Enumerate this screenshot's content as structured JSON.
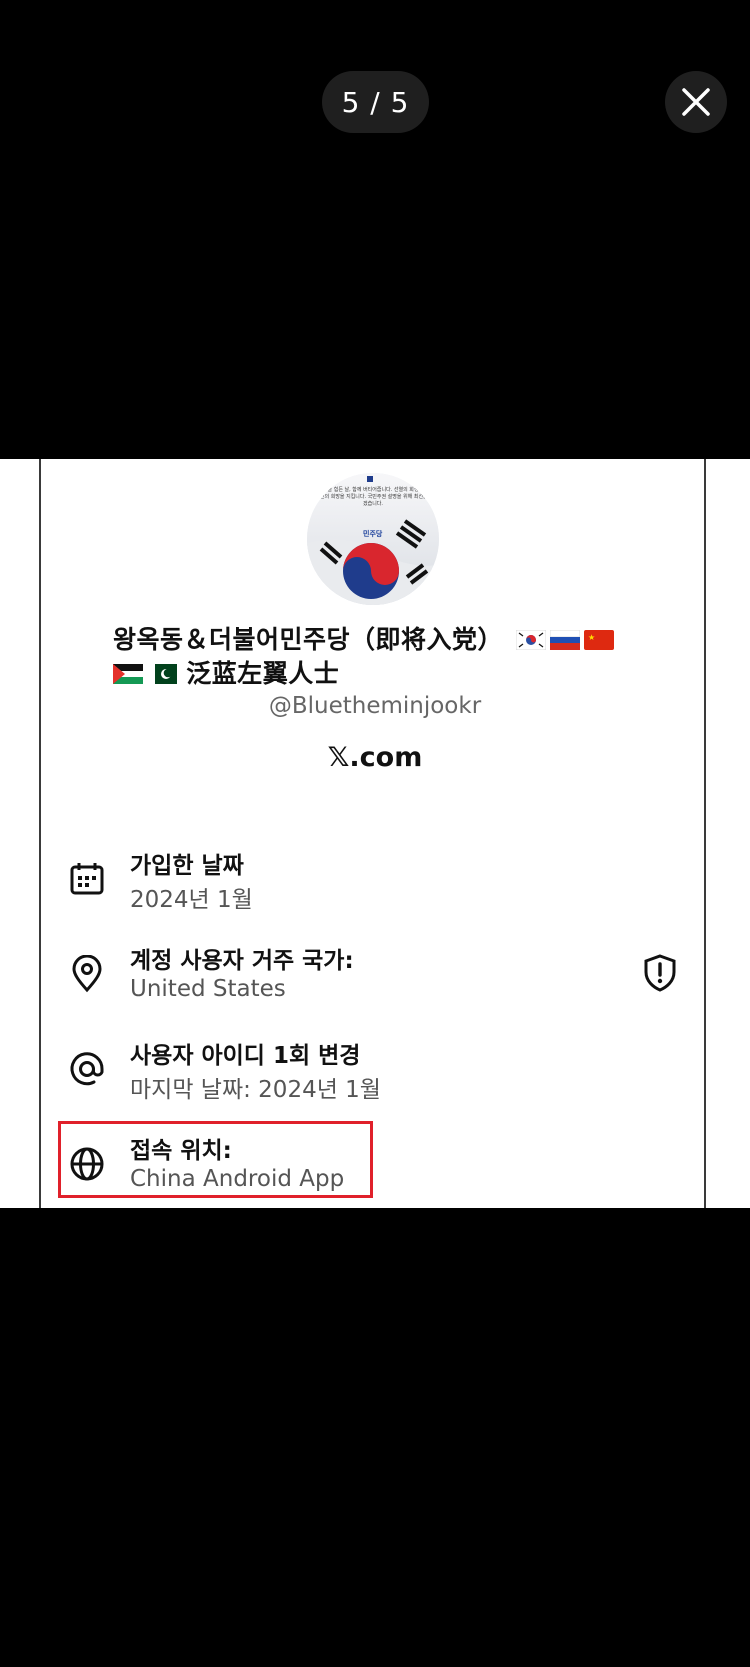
{
  "viewer": {
    "counter": "5 / 5",
    "close_icon": "close-icon"
  },
  "profile": {
    "avatar_text": "나라만 믿을 힘든 날, 함께 버티어줍니다. 선열의 희생을 이어나며, 국민의 희망을 지킵니다. 국민주권 설명을 위해 최선을 다하겠습니다.",
    "avatar_party": "민주당",
    "name_part1": "왕옥동＆더불어민주당（即将入党）",
    "name_part2": "泛蓝左翼人士",
    "flags": [
      "south-korea-flag",
      "russia-flag",
      "china-flag",
      "palestine-flag",
      "pakistan-flag"
    ],
    "handle": "@Bluetheminjookr",
    "site": "𝕏.com"
  },
  "details": [
    {
      "icon": "calendar-icon",
      "label": "가입한 날짜",
      "value": "2024년 1월"
    },
    {
      "icon": "location-pin-icon",
      "label": "계정 사용자 거주 국가:",
      "value": "United States"
    },
    {
      "icon": "at-sign-icon",
      "label": "사용자 아이디 1회 변경",
      "value": "마지막 날짜: 2024년 1월"
    },
    {
      "icon": "globe-icon",
      "label": "접속 위치:",
      "value": "China Android App"
    }
  ],
  "side_icon": "shield-alert-icon",
  "colors": {
    "highlight": "#e0202a",
    "background": "#000000",
    "card": "#ffffff"
  }
}
